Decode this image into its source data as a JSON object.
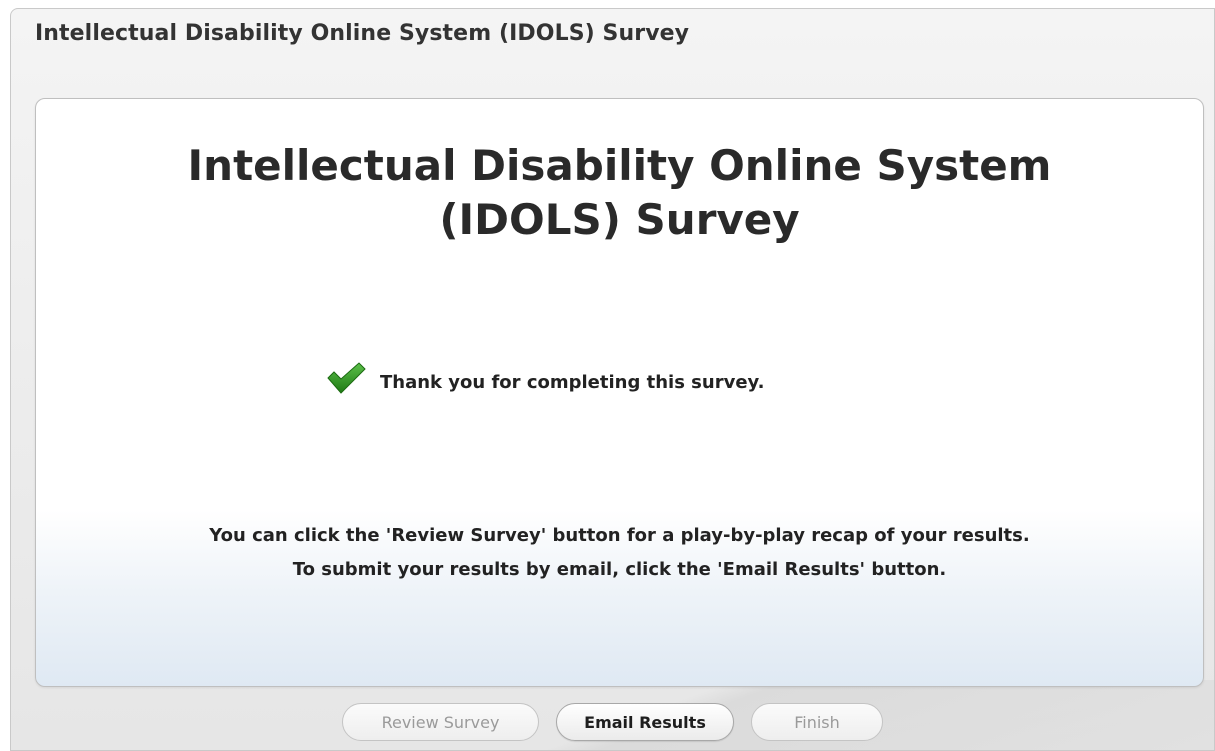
{
  "window": {
    "title": "Intellectual Disability Online System (IDOLS) Survey"
  },
  "card": {
    "title": "Intellectual Disability Online System (IDOLS) Survey",
    "status_icon": "check-icon",
    "thank_you": "Thank you for completing this survey.",
    "instructions": [
      "You can click the 'Review Survey' button for a play-by-play recap of your results.",
      "To submit your results by email, click the 'Email Results' button."
    ]
  },
  "buttons": {
    "review": "Review Survey",
    "email": "Email Results",
    "finish": "Finish"
  },
  "colors": {
    "check": "#2e8b1f",
    "title_text": "#2a2a2a",
    "disabled_text": "#9a9a9a"
  }
}
